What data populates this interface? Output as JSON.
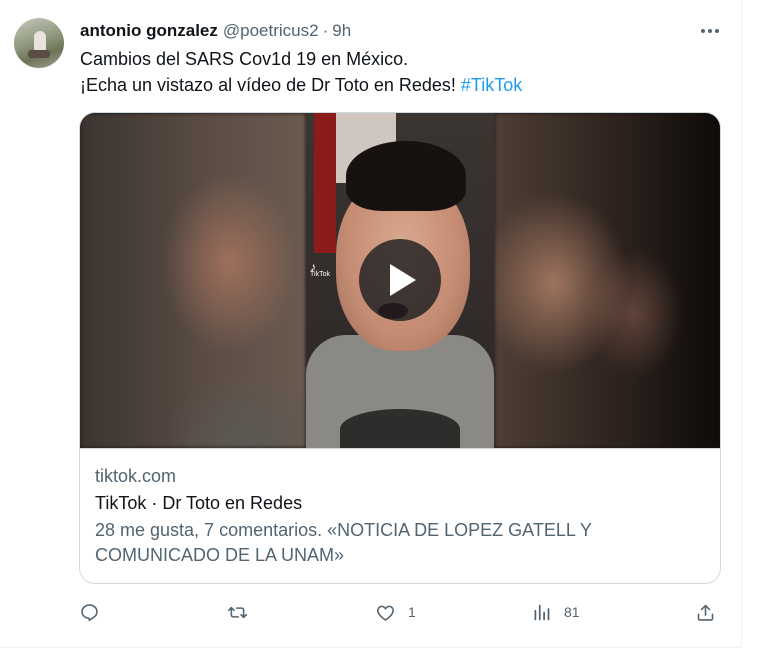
{
  "tweet": {
    "author_name": "antonio gonzalez",
    "author_handle": "@poetricus2",
    "separator": "·",
    "time": "9h",
    "text_line1": "Cambios del SARS Cov1d 19 en México.",
    "text_line2_prefix": "¡Echa un vistazo al vídeo de Dr Toto en Redes! ",
    "hashtag": "#TikTok"
  },
  "card": {
    "domain": "tiktok.com",
    "title": "TikTok · Dr Toto en Redes",
    "description_line1": "28 me gusta, 7 comentarios. «NOTICIA DE LOPEZ GATELL Y",
    "description_line2": "COMUNICADO DE LA UNAM»",
    "watermark": "TikTok",
    "watermark_glyph": "♪"
  },
  "actions": {
    "reply_count": "",
    "retweet_count": "",
    "like_count": "1",
    "views_count": "81"
  },
  "icons": {
    "more": "more-dots-icon",
    "reply": "reply-icon",
    "retweet": "retweet-icon",
    "like": "heart-icon",
    "views": "views-chart-icon",
    "share": "share-icon",
    "play": "play-icon"
  },
  "colors": {
    "accent": "#1d9bf0",
    "secondary_text": "#536471",
    "primary_text": "#0f1419",
    "border": "#cfd9de"
  }
}
